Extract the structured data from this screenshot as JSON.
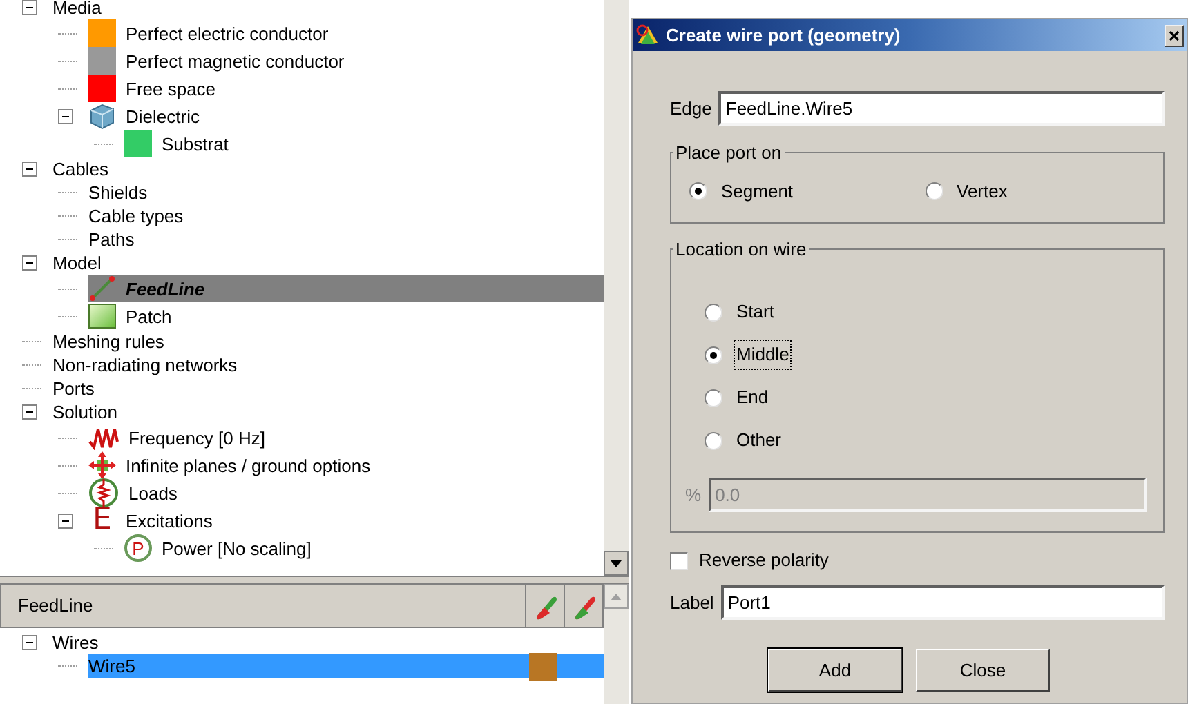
{
  "tree": [
    {
      "label": "Media",
      "expanded": true,
      "children": [
        {
          "label": "Perfect electric conductor",
          "kind": "swatch",
          "color": "#ff9900"
        },
        {
          "label": "Perfect magnetic conductor",
          "kind": "swatch",
          "color": "#999999"
        },
        {
          "label": "Free space",
          "kind": "swatch",
          "color": "#ff0000"
        },
        {
          "label": "Dielectric",
          "kind": "cube",
          "expanded": true,
          "children": [
            {
              "label": "Substrat",
              "kind": "swatch",
              "color": "#33cc66"
            }
          ]
        }
      ]
    },
    {
      "label": "Cables",
      "expanded": true,
      "children": [
        {
          "label": "Shields"
        },
        {
          "label": "Cable types"
        },
        {
          "label": "Paths"
        }
      ]
    },
    {
      "label": "Model",
      "expanded": true,
      "children": [
        {
          "label": "FeedLine",
          "kind": "wire",
          "selected": true
        },
        {
          "label": "Patch",
          "kind": "patch",
          "selected": false
        }
      ]
    },
    {
      "label": "Meshing rules"
    },
    {
      "label": "Non-radiating networks"
    },
    {
      "label": "Ports"
    },
    {
      "label": "Solution",
      "expanded": true,
      "children": [
        {
          "label": "Frequency [0 Hz]",
          "kind": "wave"
        },
        {
          "label": "Infinite planes / ground options",
          "kind": "arrows"
        },
        {
          "label": "Loads",
          "kind": "coil"
        },
        {
          "label": "Excitations",
          "kind": "letter",
          "glyph": "E",
          "expanded": true,
          "children": [
            {
              "label": "Power [No scaling]",
              "kind": "circle-letter",
              "glyph": "P"
            }
          ]
        }
      ]
    }
  ],
  "detail_pane": {
    "title": "FeedLine",
    "tree": [
      {
        "label": "Wires",
        "expanded": true,
        "children": [
          {
            "label": "Wire5",
            "kind": "trailing-swatch",
            "color": "#b87624",
            "selected": true
          }
        ]
      }
    ]
  },
  "dialog": {
    "title": "Create wire port (geometry)",
    "edge": {
      "label": "Edge",
      "value": "FeedLine.Wire5"
    },
    "place_port_on": {
      "title": "Place port on",
      "options": [
        {
          "label": "Segment",
          "selected": true
        },
        {
          "label": "Vertex",
          "selected": false
        }
      ]
    },
    "location_on_wire": {
      "title": "Location on wire",
      "options": [
        {
          "label": "Start",
          "selected": false,
          "focused": false
        },
        {
          "label": "Middle",
          "selected": true,
          "focused": true
        },
        {
          "label": "End",
          "selected": false,
          "focused": false
        },
        {
          "label": "Other",
          "selected": false,
          "focused": false
        }
      ],
      "percent": {
        "label": "%",
        "value": "0.0",
        "disabled": true
      }
    },
    "reverse_polarity": {
      "label": "Reverse polarity",
      "checked": false
    },
    "label_field": {
      "label": "Label",
      "value": "Port1"
    },
    "buttons": [
      {
        "label": "Add",
        "default": true
      },
      {
        "label": "Close",
        "default": false
      }
    ]
  }
}
